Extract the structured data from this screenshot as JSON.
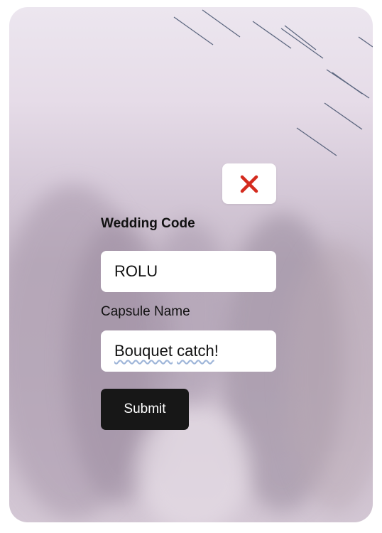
{
  "form": {
    "wedding_code_label": "Wedding Code",
    "wedding_code_value": "ROLU",
    "capsule_name_label": "Capsule Name",
    "capsule_name_value_word1": "Bouquet",
    "capsule_name_value_space": " ",
    "capsule_name_value_word2": "catch",
    "capsule_name_value_end": "!",
    "submit_label": "Submit"
  },
  "icons": {
    "close": "close-icon"
  },
  "colors": {
    "close_icon": "#d42b1e",
    "submit_bg": "#171717",
    "field_bg": "#ffffff"
  }
}
